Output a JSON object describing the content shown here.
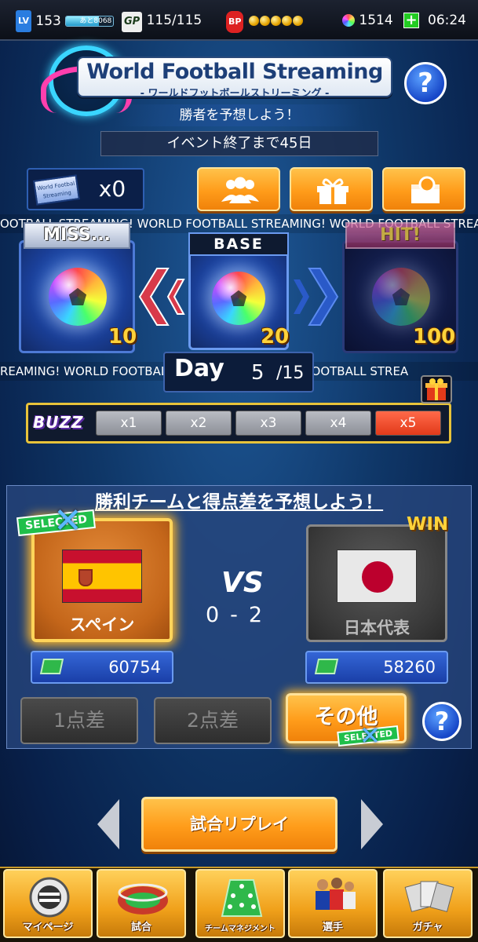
{
  "status_bar": {
    "level_badge": "LV",
    "level": "153",
    "xp_label": "あと8068",
    "xp_fraction": 0.7,
    "gp_badge": "GP",
    "gp_value": "115/115",
    "bp_badge": "BP",
    "bp_coins": 5,
    "gems": "1514",
    "plus": "+",
    "time": "06:24"
  },
  "header": {
    "title": "World Football Streaming",
    "subtitle": "- ワールドフットボールストリーミング -",
    "help": "?",
    "predict_banner": "勝者を予想しよう！",
    "event_banner": "イベント終了まで45日"
  },
  "ticket": {
    "icon_text": "World Footbal Streaming",
    "count": "x0"
  },
  "icon_buttons": [
    {
      "name": "friends-button",
      "icon": "people-icon"
    },
    {
      "name": "gift-button",
      "icon": "gift-icon"
    },
    {
      "name": "search-button",
      "icon": "magnifier-icon"
    }
  ],
  "marquee_top": "OOTBALL STREAMING!  WORLD FOOTBALL STREAMING!  WORLD FOOTBALL STREAMING!  WORLD FOOT",
  "marquee_bottom": "REAMING!  WORLD FOOTBALL STREAMING!  WORLD FOOTBALL STREA",
  "cards": {
    "miss": {
      "label": "MISS...",
      "value": "10"
    },
    "base": {
      "label": "BASE",
      "value": "20"
    },
    "hit": {
      "label": "HIT!",
      "value": "100"
    }
  },
  "day": {
    "label": "Day",
    "current": "5",
    "total": "/15"
  },
  "buzz": {
    "logo": "BUZZ",
    "multipliers": [
      "x1",
      "x2",
      "x3",
      "x4",
      "x5"
    ],
    "active_index": 4
  },
  "prediction": {
    "title": "勝利チームと得点差を予想しよう！",
    "selected_tag": "SELECTED",
    "vs": "VS",
    "score_home": "0",
    "score_sep": "-",
    "score_away": "2",
    "win_tag": "WIN",
    "home": {
      "name": "スペイン",
      "supporters": "60754"
    },
    "away": {
      "name": "日本代表",
      "supporters": "58260"
    },
    "margins": [
      "1点差",
      "2点差",
      "その他"
    ],
    "help": "?"
  },
  "replay": {
    "label": "試合リプレイ"
  },
  "bottom_nav": [
    {
      "label": "マイページ",
      "icon": "mypage-icon"
    },
    {
      "label": "試合",
      "icon": "stadium-icon"
    },
    {
      "label": "チームマネジメント",
      "icon": "tactics-board-icon"
    },
    {
      "label": "選手",
      "icon": "players-icon"
    },
    {
      "label": "ガチャ",
      "icon": "cards-icon"
    }
  ],
  "colors": {
    "accent_orange": "#ff9c1a",
    "selected_green": "#1fbf4a",
    "buzz_active": "#e23a1a"
  }
}
